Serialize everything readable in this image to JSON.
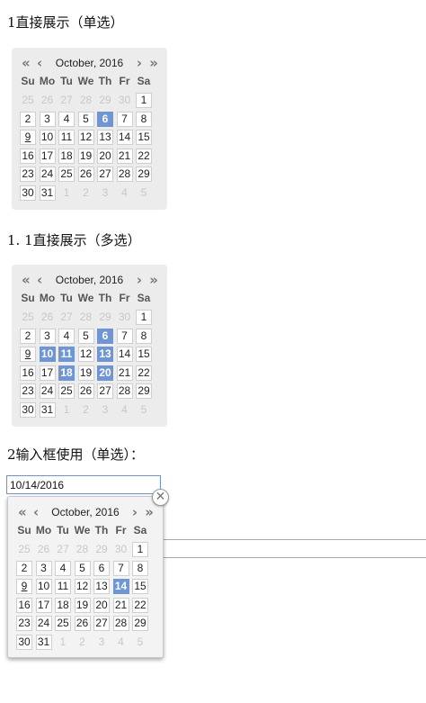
{
  "section1": {
    "heading": "1直接展示（单选）"
  },
  "section2": {
    "heading": "1. 1直接展示（多选）"
  },
  "section3": {
    "heading": "2输入框使用（单选）：",
    "input_value": "10/14/2016"
  },
  "calendar": {
    "title": "October, 2016",
    "nav_icons": [
      "prev-year-icon",
      "prev-month-icon",
      "next-month-icon",
      "next-year-icon"
    ],
    "weekdays": [
      "Su",
      "Mo",
      "Tu",
      "We",
      "Th",
      "Fr",
      "Sa"
    ],
    "days": [
      [
        "25",
        "26",
        "27",
        "28",
        "29",
        "30",
        "1"
      ],
      [
        "2",
        "3",
        "4",
        "5",
        "6",
        "7",
        "8"
      ],
      [
        "9",
        "10",
        "11",
        "12",
        "13",
        "14",
        "15"
      ],
      [
        "16",
        "17",
        "18",
        "19",
        "20",
        "21",
        "22"
      ],
      [
        "23",
        "24",
        "25",
        "26",
        "27",
        "28",
        "29"
      ],
      [
        "30",
        "31",
        "1",
        "2",
        "3",
        "4",
        "5"
      ]
    ],
    "other_month_cells": [
      [
        0,
        0
      ],
      [
        0,
        1
      ],
      [
        0,
        2
      ],
      [
        0,
        3
      ],
      [
        0,
        4
      ],
      [
        0,
        5
      ],
      [
        5,
        2
      ],
      [
        5,
        3
      ],
      [
        5,
        4
      ],
      [
        5,
        5
      ],
      [
        5,
        6
      ]
    ],
    "today_cell": [
      2,
      0
    ],
    "selected_color": "#6f95d3"
  },
  "calendars": [
    {
      "id": "single",
      "selected": [
        [
          1,
          4
        ]
      ]
    },
    {
      "id": "multi",
      "selected": [
        [
          1,
          4
        ],
        [
          2,
          1
        ],
        [
          2,
          2
        ],
        [
          2,
          4
        ],
        [
          3,
          2
        ],
        [
          3,
          4
        ]
      ]
    },
    {
      "id": "input",
      "selected": [
        [
          2,
          5
        ]
      ]
    }
  ],
  "close_icon": "close-icon"
}
